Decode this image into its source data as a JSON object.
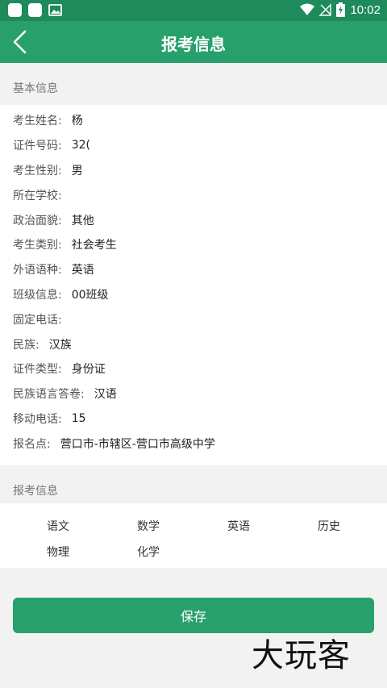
{
  "status_bar": {
    "time": "10:02"
  },
  "app_bar": {
    "title": "报考信息"
  },
  "basic_section": {
    "title": "基本信息"
  },
  "basic_info": [
    {
      "label": "考生姓名:",
      "value": "杨"
    },
    {
      "label": "证件号码:",
      "value": "32("
    },
    {
      "label": "考生性别:",
      "value": "男"
    },
    {
      "label": "所在学校:",
      "value": ""
    },
    {
      "label": "政治面貌:",
      "value": "其他"
    },
    {
      "label": "考生类别:",
      "value": "社会考生"
    },
    {
      "label": "外语语种:",
      "value": "英语"
    },
    {
      "label": "班级信息:",
      "value": "00班级"
    },
    {
      "label": "固定电话:",
      "value": ""
    },
    {
      "label": "民族:",
      "value": "汉族"
    },
    {
      "label": "证件类型:",
      "value": "身份证"
    },
    {
      "label": "民族语言答卷:",
      "value": "汉语"
    },
    {
      "label": "移动电话:",
      "value": "15"
    },
    {
      "label": "报名点:",
      "value": "营口市-市辖区-营口市高级中学"
    }
  ],
  "exam_section": {
    "title": "报考信息"
  },
  "subjects": [
    "语文",
    "数学",
    "英语",
    "历史",
    "物理",
    "化学"
  ],
  "save_button": {
    "label": "保存"
  },
  "watermark": {
    "text": "大玩客"
  },
  "colors": {
    "status_bar": "#1f8a5c",
    "app_bar": "#27a06b",
    "save_button": "#28a06c"
  }
}
